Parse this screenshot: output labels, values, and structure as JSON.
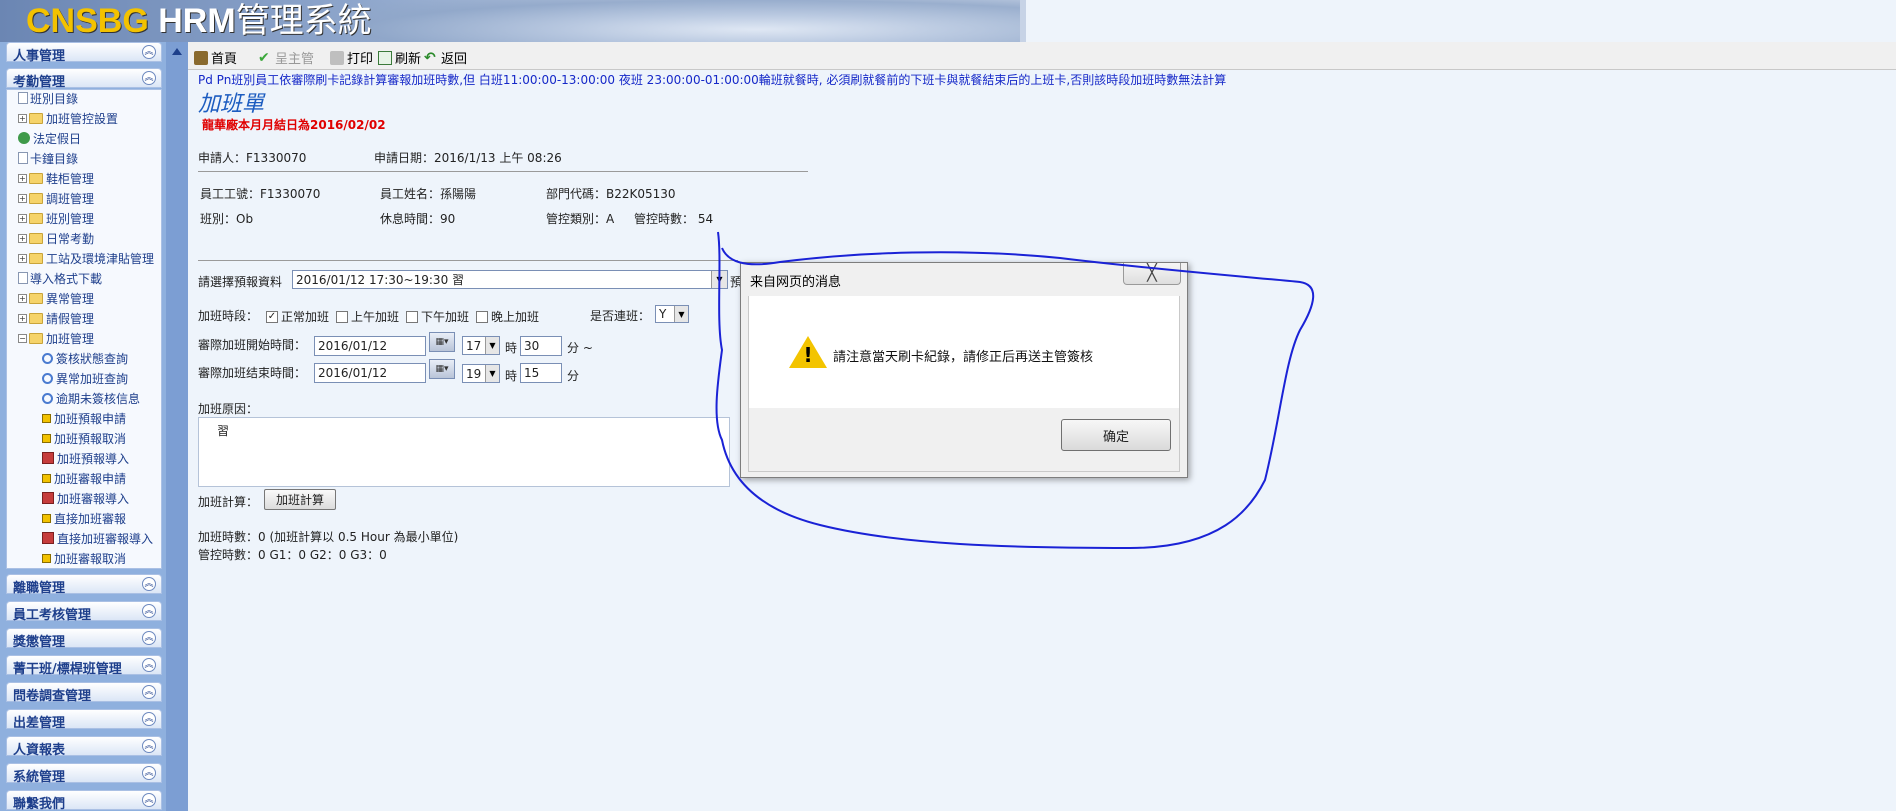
{
  "banner": {
    "logo_a": "CNSBG",
    "logo_b": " HRM",
    "logo_c": "管理系統"
  },
  "sidebar": {
    "top_sections": [
      {
        "label": "人事管理"
      },
      {
        "label": "考勤管理"
      }
    ],
    "menu_items": [
      {
        "label": "班別目錄",
        "icon": "doc-icon"
      },
      {
        "label": "加班管控設置",
        "icon": "folder-icon"
      },
      {
        "label": "法定假日",
        "icon": "tree-icon"
      },
      {
        "label": "卡鐘目錄",
        "icon": "doc-icon"
      },
      {
        "label": "鞋柜管理",
        "icon": "folder-icon"
      },
      {
        "label": "調班管理",
        "icon": "folder-icon"
      },
      {
        "label": "班別管理",
        "icon": "folder-icon"
      },
      {
        "label": "日常考勤",
        "icon": "folder-icon"
      },
      {
        "label": "工站及環境津貼管理",
        "icon": "folder-icon"
      },
      {
        "label": "導入格式下載",
        "icon": "doc-icon"
      },
      {
        "label": "異常管理",
        "icon": "folder-icon"
      },
      {
        "label": "請假管理",
        "icon": "folder-icon"
      },
      {
        "label": "加班管理",
        "icon": "folder-icon"
      },
      {
        "label": "簽核狀態查詢",
        "icon": "magnifier-icon"
      },
      {
        "label": "異常加班查詢",
        "icon": "magnifier-icon"
      },
      {
        "label": "逾期未簽核信息",
        "icon": "magnifier-icon"
      },
      {
        "label": "加班預報申請",
        "icon": "square-icon"
      },
      {
        "label": "加班預報取消",
        "icon": "square-icon"
      },
      {
        "label": "加班預報導入",
        "icon": "excel-icon"
      },
      {
        "label": "加班審報申請",
        "icon": "square-icon"
      },
      {
        "label": "加班審報導入",
        "icon": "excel-icon"
      },
      {
        "label": "直接加班審報",
        "icon": "square-icon"
      },
      {
        "label": "直接加班審報導入",
        "icon": "excel-icon"
      },
      {
        "label": "加班審報取消",
        "icon": "square-icon"
      }
    ],
    "bottom_sections": [
      {
        "label": "離職管理"
      },
      {
        "label": "員工考核管理"
      },
      {
        "label": "獎懲管理"
      },
      {
        "label": "菁干班/標桿班管理"
      },
      {
        "label": "問卷調查管理"
      },
      {
        "label": "出差管理"
      },
      {
        "label": "人資報表"
      },
      {
        "label": "系統管理"
      },
      {
        "label": "聯繫我們"
      }
    ],
    "collapse_glyph": "︽"
  },
  "toolbar": {
    "home": "首頁",
    "submit": "呈主管",
    "print": "打印",
    "refresh": "刷新",
    "back": "返回"
  },
  "form": {
    "notice": "Pd Pn班別員工依審際刷卡記錄計算審報加班時數,但 白班11:00:00-13:00:00 夜班 23:00:00-01:00:00輪班就餐時, 必須刷就餐前的下班卡與就餐結束后的上班卡,否則該時段加班時數無法計算",
    "title": "加班單",
    "month_end_note": "龍華廠本月月結日為2016/02/02",
    "applicant_label": "申請人：",
    "applicant": "F1330070",
    "apply_date_label": "申請日期：",
    "apply_date": "2016/1/13 上午 08:26",
    "emp_no_label": "員工工號：",
    "emp_no": "F1330070",
    "emp_name_label": "員工姓名：",
    "emp_name": "孫陽陽",
    "dept_label": "部門代碼：",
    "dept": "B22K05130",
    "shift_label": "班別：",
    "shift": "Ob",
    "rest_label": "休息時間：",
    "rest": "90",
    "ctrl_type_label": "管控類別：",
    "ctrl_type": "A",
    "ctrl_hours_label": "管控時數：",
    "ctrl_hours": "54",
    "pre_report_label": "請選擇預報資料",
    "pre_report_value": "2016/01/12 17:30~19:30      習",
    "pre_report_suffix": "預",
    "period_label": "加班時段：",
    "period_normal": "正常加班",
    "period_morning": "上午加班",
    "period_afternoon": "下午加班",
    "period_evening": "晚上加班",
    "continuous_label": "是否連班：",
    "continuous_value": "Y",
    "start_label": "審際加班開始時間：",
    "start_date": "2016/01/12",
    "start_hour": "17",
    "start_min": "30",
    "end_label": "審際加班结束時間：",
    "end_date": "2016/01/12",
    "end_hour": "19",
    "end_min": "15",
    "hour_unit": "時",
    "min_unit_start": "分 ~",
    "min_unit_end": "分",
    "reason_label": "加班原因：",
    "reason": "習",
    "calc_label": "加班計算：",
    "calc_button": "加班計算",
    "ot_hours_line": "加班時數：0 (加班計算以 0.5 Hour 為最小單位)",
    "ctrl_hours_line": "管控時數：0 G1：0  G2：0  G3：0"
  },
  "dialog": {
    "title": "来自网页的消息",
    "close": "╳",
    "message": "請注意當天刷卡紀錄，請修正后再送主管簽核",
    "ok": "确定"
  }
}
